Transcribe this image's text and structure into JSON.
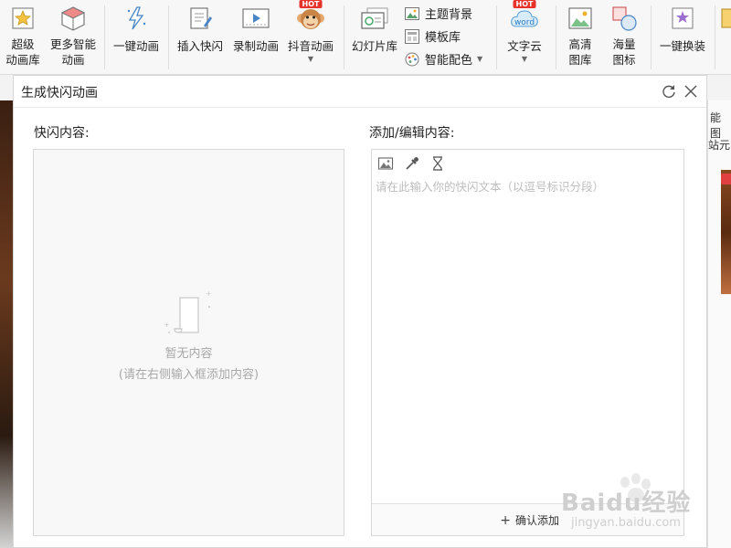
{
  "ribbon": {
    "super_anim_lib": "超级\n动画库",
    "more_smart_anim": "更多智能\n动画",
    "one_key_anim": "一键动画",
    "insert_flash": "插入快闪",
    "record_anim": "录制动画",
    "douyin_anim": "抖音动画",
    "slide_lib": "幻灯片库",
    "theme_bg": "主题背景",
    "template_lib": "模板库",
    "smart_color": "智能配色",
    "word_cloud": "文字云",
    "hd_images": "高清\n图库",
    "massive_icons": "海量\n图标",
    "one_key_swap": "一键换装",
    "hot_badge": "HOT",
    "word_icon_text": "word"
  },
  "background": {
    "right_text_1": "能图",
    "right_text_2": "站元"
  },
  "dialog": {
    "title": "生成快闪动画",
    "left_label": "快闪内容:",
    "right_label": "添加/编辑内容:",
    "empty_title": "暂无内容",
    "empty_subtitle": "(请在右侧输入框添加内容)",
    "input_placeholder": "请在此输入你的快闪文本（以逗号标识分段）",
    "add_button": "确认添加",
    "add_icon": "+"
  },
  "watermark": {
    "brand": "Baidu经验",
    "url": "jingyan.baidu.com"
  },
  "colors": {
    "accent_red": "#e6322a",
    "panel_bg": "#f8f8f8",
    "placeholder": "#bdbdbd"
  },
  "icons": {
    "refresh": "refresh-icon",
    "close": "close-icon",
    "image_tool": "image-icon",
    "eyedropper_tool": "eyedropper-icon",
    "timer_tool": "hourglass-icon"
  }
}
